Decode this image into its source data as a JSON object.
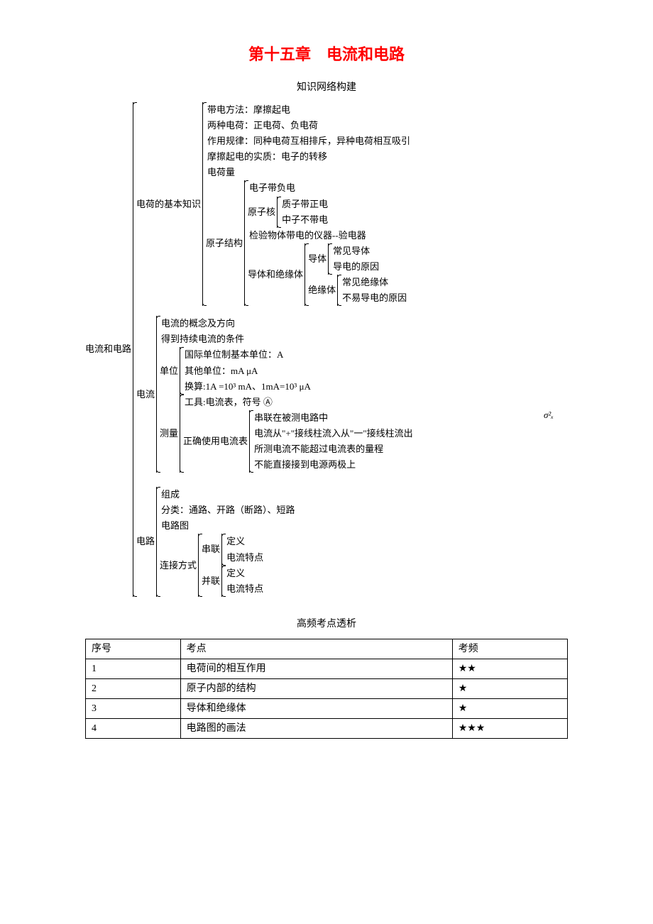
{
  "title": "第十五章　电流和电路",
  "subtitle": "知识网络构建",
  "sigma": "σ²ₓ",
  "tree": {
    "root": "电流和电路",
    "section1": {
      "label": "电荷的基本知识",
      "items": {
        "i1": "带电方法：摩擦起电",
        "i2": "两种电荷：正电荷、负电荷",
        "i3": "作用规律：同种电荷互相排斥，异种电荷相互吸引",
        "i4": "摩擦起电的实质：电子的转移",
        "i5": "电荷量"
      },
      "atom": {
        "label": "原子结构",
        "electron": "电子带负电",
        "nucleus": {
          "label": "原子核",
          "proton": "质子带正电",
          "neutron": "中子不带电"
        },
        "instrument": "检验物体带电的仪器--验电器",
        "conduct": {
          "label": "导体和绝缘体",
          "conductor": {
            "label": "导体",
            "c1": "常见导体",
            "c2": "导电的原因"
          },
          "insulator": {
            "label": "绝缘体",
            "n1": "常见绝缘体",
            "n2": "不易导电的原因"
          }
        }
      }
    },
    "section2": {
      "label": "电流",
      "i1": "电流的概念及方向",
      "i2": "得到持续电流的条件",
      "unit": {
        "label": "单位",
        "u1": "国际单位制基本单位：A",
        "u2": "其他单位：mA μA",
        "u3": "换算:1A =10³ mA、1mA=10³ μA"
      },
      "measure": {
        "label": "测量",
        "tool": "工具:电流表，符号 Ⓐ",
        "usage": {
          "label": "正确使用电流表",
          "m1": "串联在被测电路中",
          "m2": "电流从\"+\"接线柱流入从\"一\"接线柱流出",
          "m3": "所测电流不能超过电流表的量程",
          "m4": "不能直接接到电源两极上"
        }
      }
    },
    "section3": {
      "label": "电路",
      "i1": "组成",
      "i2": "分类：通路、开路（断路）、短路",
      "i3": "电路图",
      "connect": {
        "label": "连接方式",
        "series": {
          "label": "串联",
          "s1": "定义",
          "s2": "电流特点"
        },
        "parallel": {
          "label": "并联",
          "p1": "定义",
          "p2": "电流特点"
        }
      }
    }
  },
  "table_title": "高频考点透析",
  "table": {
    "headers": {
      "col1": "序号",
      "col2": "考点",
      "col3": "考频"
    },
    "rows": [
      {
        "num": "1",
        "point": "电荷间的相互作用",
        "freq": "★★"
      },
      {
        "num": "2",
        "point": "原子内部的结构",
        "freq": "★"
      },
      {
        "num": "3",
        "point": "导体和绝缘体",
        "freq": "★"
      },
      {
        "num": "4",
        "point": "电路图的画法",
        "freq": "★★★"
      }
    ]
  }
}
